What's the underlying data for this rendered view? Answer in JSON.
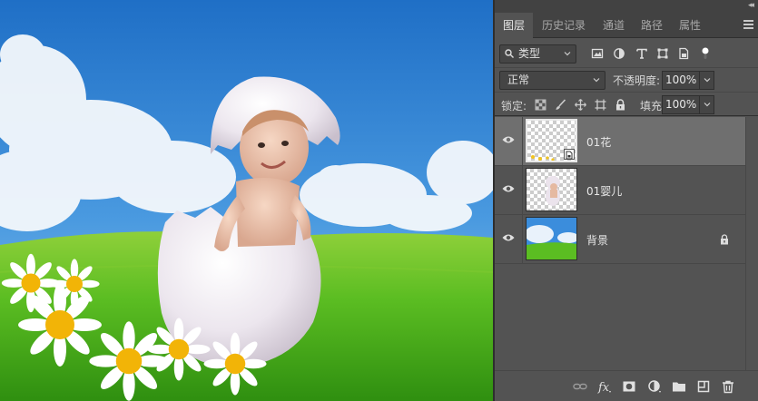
{
  "panel_tabs": [
    {
      "label": "图层",
      "active": true
    },
    {
      "label": "历史记录",
      "active": false
    },
    {
      "label": "通道",
      "active": false
    },
    {
      "label": "路径",
      "active": false
    },
    {
      "label": "属性",
      "active": false
    }
  ],
  "filter": {
    "kind_label": "类型"
  },
  "blend": {
    "mode": "正常",
    "opacity_label": "不透明度:",
    "opacity_value": "100%"
  },
  "lock": {
    "label": "锁定:",
    "fill_label": "填充:",
    "fill_value": "100%"
  },
  "layers": [
    {
      "name": "01花",
      "selected": true,
      "visible": true,
      "locked": false
    },
    {
      "name": "01婴儿",
      "selected": false,
      "visible": true,
      "locked": false
    },
    {
      "name": "背景",
      "selected": false,
      "visible": true,
      "locked": true
    }
  ],
  "colors": {
    "panel_bg": "#535353",
    "tab_bg": "#424242",
    "selected_layer": "#6f6f6f",
    "sky": "#2f86d8",
    "grass": "#4eb61c"
  },
  "icons": {
    "toolbar_bottom": [
      "link-layers-icon",
      "fx-icon",
      "add-mask-icon",
      "adjustment-layer-icon",
      "new-group-icon",
      "new-layer-icon",
      "trash-icon"
    ],
    "filter": [
      "filter-pixel-icon",
      "filter-adjustment-icon",
      "filter-type-icon",
      "filter-shape-icon",
      "filter-smartobject-icon",
      "filter-toggle-icon"
    ],
    "lock": [
      "lock-transparent-icon",
      "lock-paint-icon",
      "lock-position-icon",
      "lock-artboard-icon",
      "lock-all-icon"
    ]
  }
}
